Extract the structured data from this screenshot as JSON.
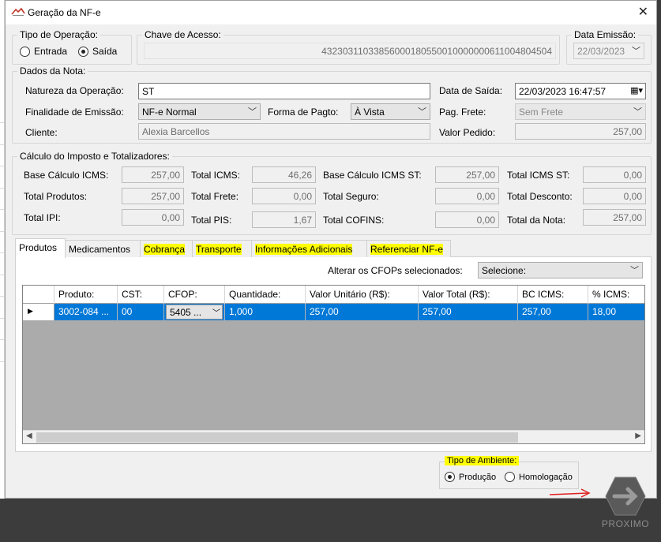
{
  "window": {
    "title": "Geração da NF-e"
  },
  "operacao": {
    "label": "Tipo de Operação:",
    "entrada": "Entrada",
    "saida": "Saída",
    "selected": "Saída"
  },
  "chave": {
    "label": "Chave de Acesso:",
    "value": "43230311033856000180550010000000611004804504"
  },
  "emissao": {
    "label": "Data Emissão:",
    "value": "22/03/2023"
  },
  "dados": {
    "group_label": "Dados da Nota:",
    "natureza_label": "Natureza da Operação:",
    "natureza_value": "ST",
    "data_saida_label": "Data de Saída:",
    "data_saida_value": "22/03/2023 16:47:57",
    "finalidade_label": "Finalidade de Emissão:",
    "finalidade_value": "NF-e Normal",
    "forma_pagto_label": "Forma de Pagto:",
    "forma_pagto_value": "À Vista",
    "pag_frete_label": "Pag. Frete:",
    "pag_frete_value": "Sem Frete",
    "cliente_label": "Cliente:",
    "cliente_value": "Alexia  Barcellos",
    "valor_pedido_label": "Valor Pedido:",
    "valor_pedido_value": "257,00"
  },
  "calculo": {
    "group_label": "Cálculo do Imposto e Totalizadores:",
    "base_icms_label": "Base Cálculo ICMS:",
    "base_icms": "257,00",
    "total_icms_label": "Total ICMS:",
    "total_icms": "46,26",
    "base_icms_st_label": "Base Cálculo ICMS ST:",
    "base_icms_st": "257,00",
    "total_icms_st_label": "Total ICMS ST:",
    "total_icms_st": "0,00",
    "total_produtos_label": "Total Produtos:",
    "total_produtos": "257,00",
    "total_frete_label": "Total Frete:",
    "total_frete": "0,00",
    "total_seguro_label": "Total Seguro:",
    "total_seguro": "0,00",
    "total_desconto_label": "Total Desconto:",
    "total_desconto": "0,00",
    "total_ipi_label": "Total IPI:",
    "total_ipi": "0,00",
    "total_pis_label": "Total PIS:",
    "total_pis": "1,67",
    "total_cofins_label": "Total COFINS:",
    "total_cofins": "0,00",
    "total_nota_label": "Total da Nota:",
    "total_nota": "257,00"
  },
  "tabs": [
    "Produtos",
    "Medicamentos",
    "Cobrança",
    "Transporte",
    "Informações Adicionais",
    "Referenciar NF-e"
  ],
  "cfop_alter": {
    "label": "Alterar os CFOPs selecionados:",
    "value": "Selecione:"
  },
  "grid": {
    "columns": [
      "Produto:",
      "CST:",
      "CFOP:",
      "Quantidade:",
      "Valor Unitário (R$):",
      "Valor Total (R$):",
      "BC ICMS:",
      "% ICMS:"
    ],
    "rows": [
      [
        "3002-084 ...",
        "00",
        "5405 ...",
        "1,000",
        "257,00",
        "257,00",
        "257,00",
        "18,00"
      ]
    ]
  },
  "ambiente": {
    "label": "Tipo de Ambiente:",
    "producao": "Produção",
    "homologacao": "Homologação",
    "selected": "Produção"
  },
  "next_button": {
    "label": "PROXIMO"
  },
  "colors": {
    "selection": "#0078d7",
    "highlight": "#ffff00",
    "footer": "#3c3c3c"
  }
}
